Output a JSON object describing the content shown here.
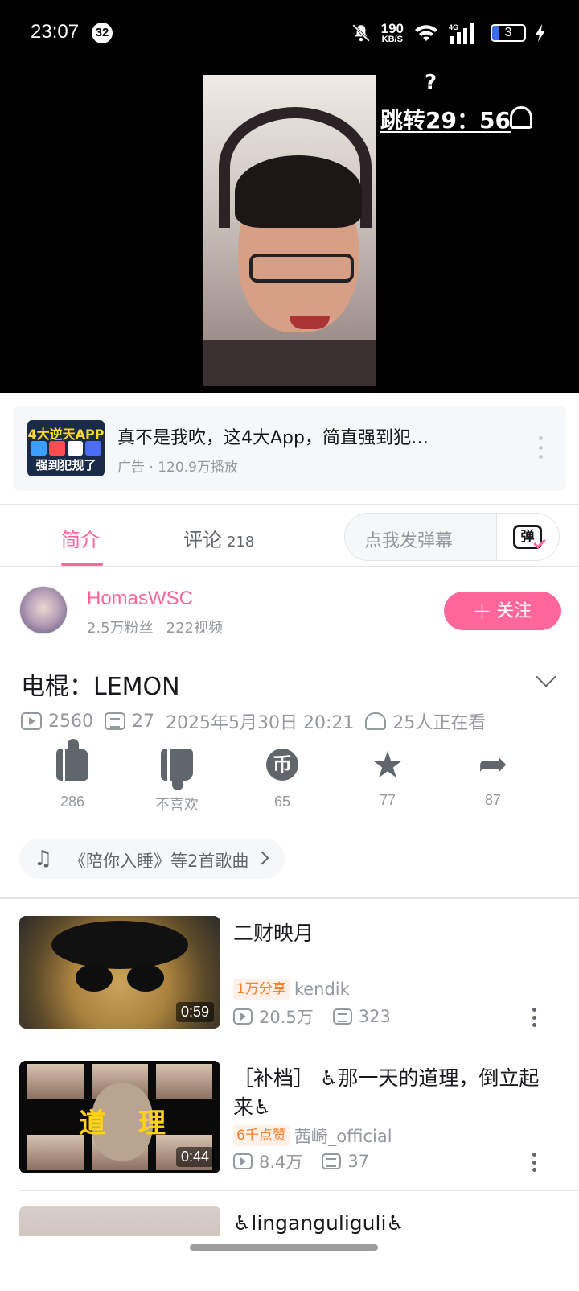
{
  "status_bar": {
    "time": "23:07",
    "notification_count": "32",
    "net_speed_value": "190",
    "net_speed_unit": "KB/S",
    "network_type": "4G",
    "battery": "3"
  },
  "player": {
    "overlay_question": "?",
    "jump_text": "跳转29：56"
  },
  "ad": {
    "thumb_top": "4大逆天APP",
    "thumb_bottom": "强到犯规了",
    "title": "真不是我吹，这4大App，简直强到犯…",
    "meta": "广告 · 120.9万播放"
  },
  "tabs": {
    "intro": "简介",
    "comments": "评论",
    "comment_count": "218",
    "danmaku_placeholder": "点我发弹幕",
    "danmaku_button": "弹"
  },
  "uploader": {
    "name": "HomasWSC",
    "fans": "2.5万粉丝",
    "videos": "222视频",
    "follow_label": "关注"
  },
  "video": {
    "title": "电棍：LEMON",
    "plays": "2560",
    "danmaku": "27",
    "date": "2025年5月30日 20:21",
    "watching": "25人正在看"
  },
  "actions": {
    "like": "286",
    "dislike": "不喜欢",
    "coin": "65",
    "coin_glyph": "币",
    "favorite": "77",
    "share": "87"
  },
  "music": {
    "text": "《陪你入睡》等2首歌曲"
  },
  "related": [
    {
      "title": "二财映月",
      "badge": "1万分享",
      "author": "kendik",
      "plays": "20.5万",
      "danmaku": "323",
      "duration": "0:59"
    },
    {
      "title": "［补档］ ♿那一天的道理，倒立起来♿",
      "badge": "6千点赞",
      "author": "茜崎_official",
      "plays": "8.4万",
      "danmaku": "37",
      "duration": "0:44",
      "thumb_text": "道理"
    },
    {
      "title": "♿linganguliguli♿"
    }
  ],
  "colors": {
    "accent": "#ff6699",
    "badge": "#ff7f24",
    "secondary_text": "#9499a0"
  }
}
